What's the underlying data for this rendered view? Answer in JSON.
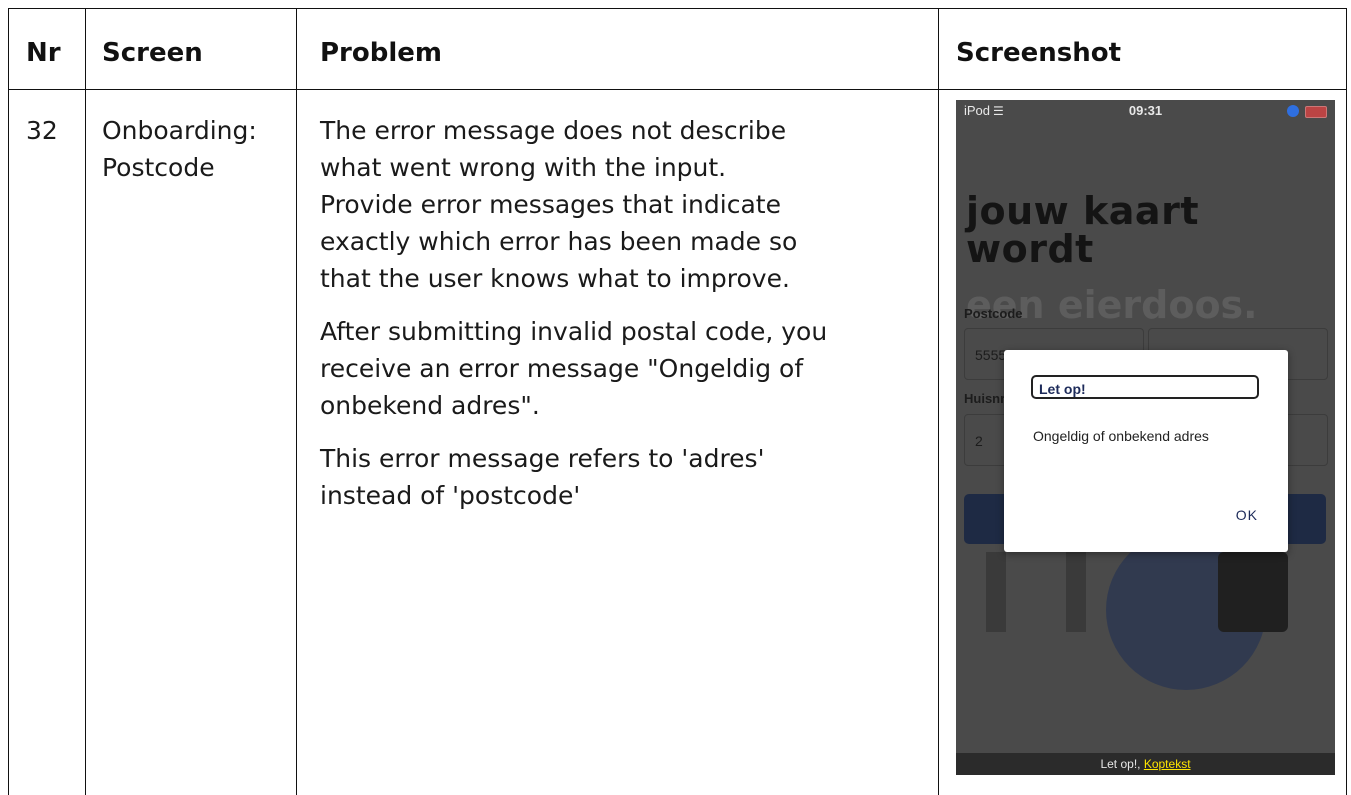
{
  "table": {
    "headers": [
      "Nr",
      "Screen",
      "Problem",
      "Screenshot"
    ],
    "row": {
      "nr": "32",
      "screen": "Onboarding:\nPostcode",
      "problem": [
        "The error message does not describe\nwhat went wrong with the input.\nProvide error messages that indicate\nexactly which error has been made so\nthat the user knows what to improve.",
        "After submitting invalid postal code, you\nreceive an error message \"Ongeldig of\nonbekend adres\".",
        "This error message refers to 'adres'\ninstead of 'postcode'"
      ]
    }
  },
  "phone": {
    "status": {
      "carrier": "iPod",
      "time": "09:31"
    },
    "headline_lines": [
      "jouw kaart",
      "wordt"
    ],
    "headline_line3": "een eierdoos.",
    "postcode_label": "Postcode",
    "postcode_value": "5555",
    "huisnummer_label": "Huisnr",
    "huisnummer_value": "2",
    "bottom_text": "Let op!,",
    "bottom_link": "Koptekst"
  },
  "dialog": {
    "title": "Let op!",
    "message": "Ongeldig of onbekend adres",
    "ok_label": "OK"
  },
  "colors": {
    "dialog_accent": "#1d2b5a",
    "overlay_dim": "#4a4a4a",
    "link_yellow": "#ffe600"
  }
}
